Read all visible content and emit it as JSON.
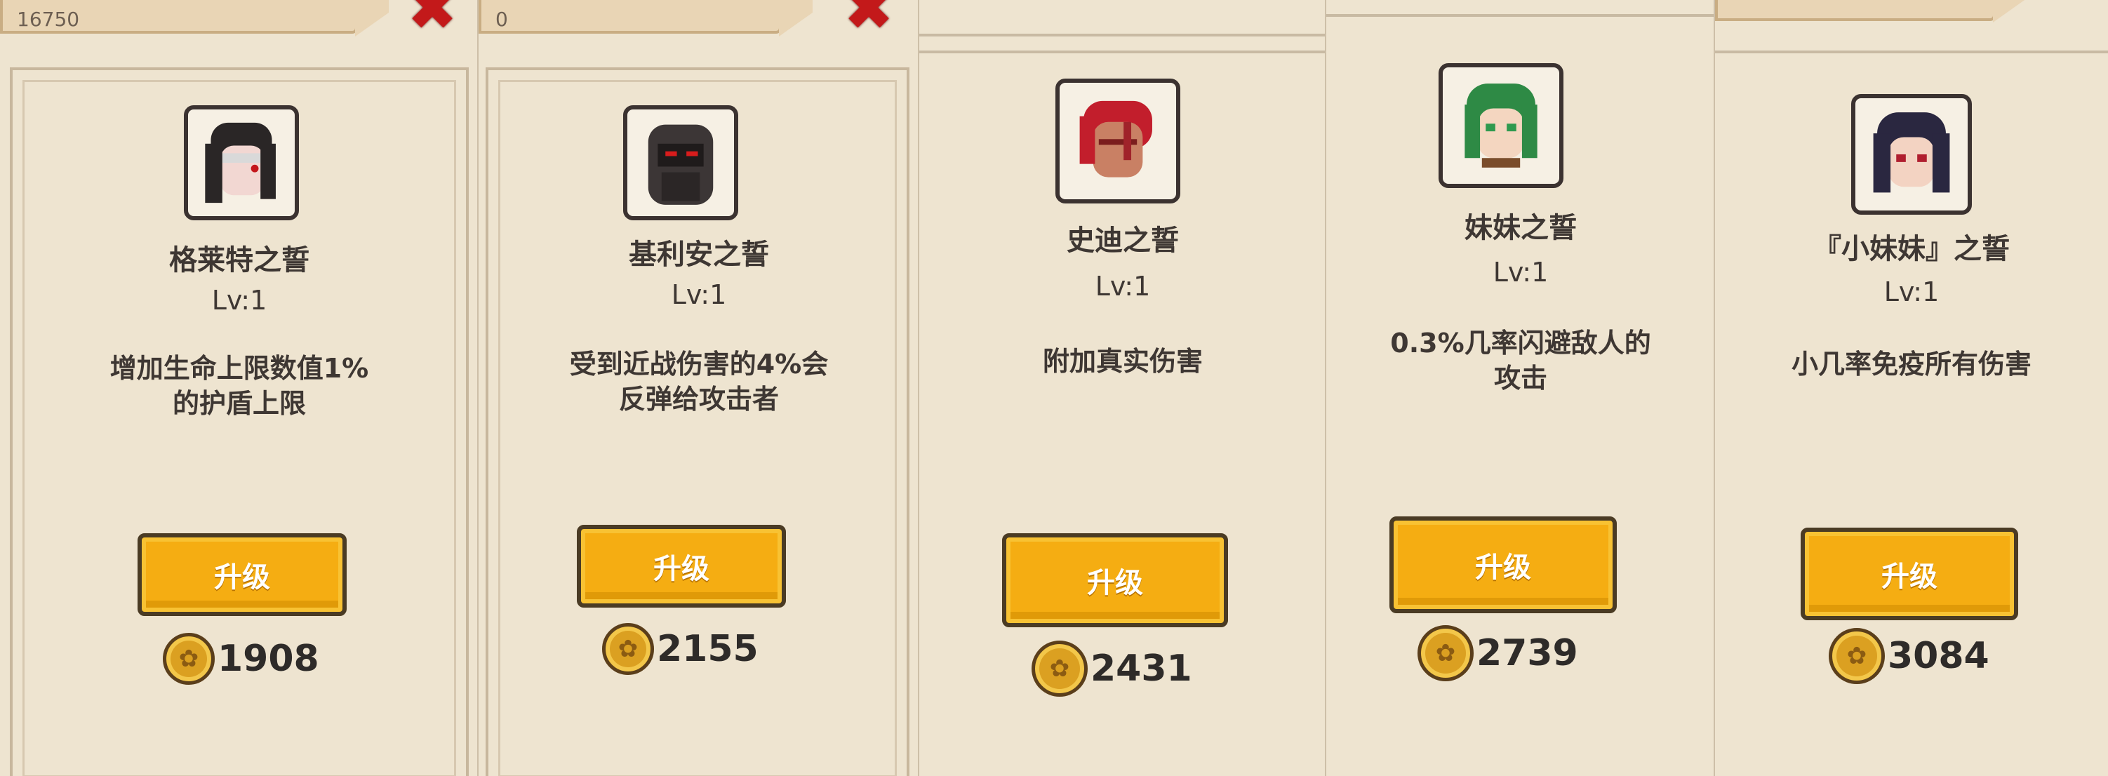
{
  "header": {
    "panel1_counter": "16750",
    "panel2_counter": "0",
    "close_glyph": "✖"
  },
  "upgrade_label": "升级",
  "cards": [
    {
      "title": "格莱特之誓",
      "level": "Lv:1",
      "desc": "增加生命上限数值1%\n的护盾上限",
      "cost": "1908",
      "portrait": "grey-haired-man-portrait"
    },
    {
      "title": "基利安之誓",
      "level": "Lv:1",
      "desc": "受到近战伤害的4%会\n反弹给攻击者",
      "cost": "2155",
      "portrait": "dark-armored-knight-portrait"
    },
    {
      "title": "史迪之誓",
      "level": "Lv:1",
      "desc": "附加真实伤害",
      "cost": "2431",
      "portrait": "red-haired-warrior-portrait"
    },
    {
      "title": "妹妹之誓",
      "level": "Lv:1",
      "desc": "0.3%几率闪避敌人的\n攻击",
      "cost": "2739",
      "portrait": "green-haired-girl-portrait"
    },
    {
      "title": "『小妹妹』之誓",
      "level": "Lv:1",
      "desc": "小几率免疫所有伤害",
      "cost": "3084",
      "portrait": "dark-haired-girl-portrait"
    }
  ],
  "colors": {
    "background": "#eee4d0",
    "button": "#f5ad12",
    "button_border": "#4a3b24",
    "close": "#c3191a",
    "coin": "#dba021"
  },
  "coin_icon": "coin-icon"
}
